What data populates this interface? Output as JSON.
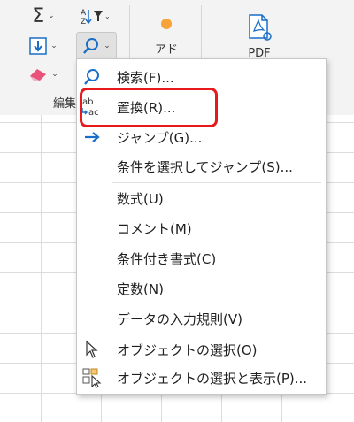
{
  "ribbon": {
    "group_label": "編集",
    "clipboard_label": "アド",
    "pdf_label": "PDF"
  },
  "menu": {
    "items": [
      {
        "label": "検索(F)...",
        "icon": "search-icon"
      },
      {
        "label": "置換(R)...",
        "icon": "replace-icon"
      },
      {
        "label": "ジャンプ(G)...",
        "icon": "arrow-right-icon"
      },
      {
        "label": "条件を選択してジャンプ(S)...",
        "icon": ""
      },
      {
        "label": "数式(U)",
        "icon": ""
      },
      {
        "label": "コメント(M)",
        "icon": ""
      },
      {
        "label": "条件付き書式(C)",
        "icon": ""
      },
      {
        "label": "定数(N)",
        "icon": ""
      },
      {
        "label": "データの入力規則(V)",
        "icon": ""
      },
      {
        "label": "オブジェクトの選択(O)",
        "icon": "pointer-icon"
      },
      {
        "label": "オブジェクトの選択と表示(P)...",
        "icon": "selection-pane-icon"
      }
    ]
  },
  "colors": {
    "highlight": "#e8191a",
    "accent_blue": "#1a6ec7",
    "ribbon_bg": "#f3f3f3"
  }
}
